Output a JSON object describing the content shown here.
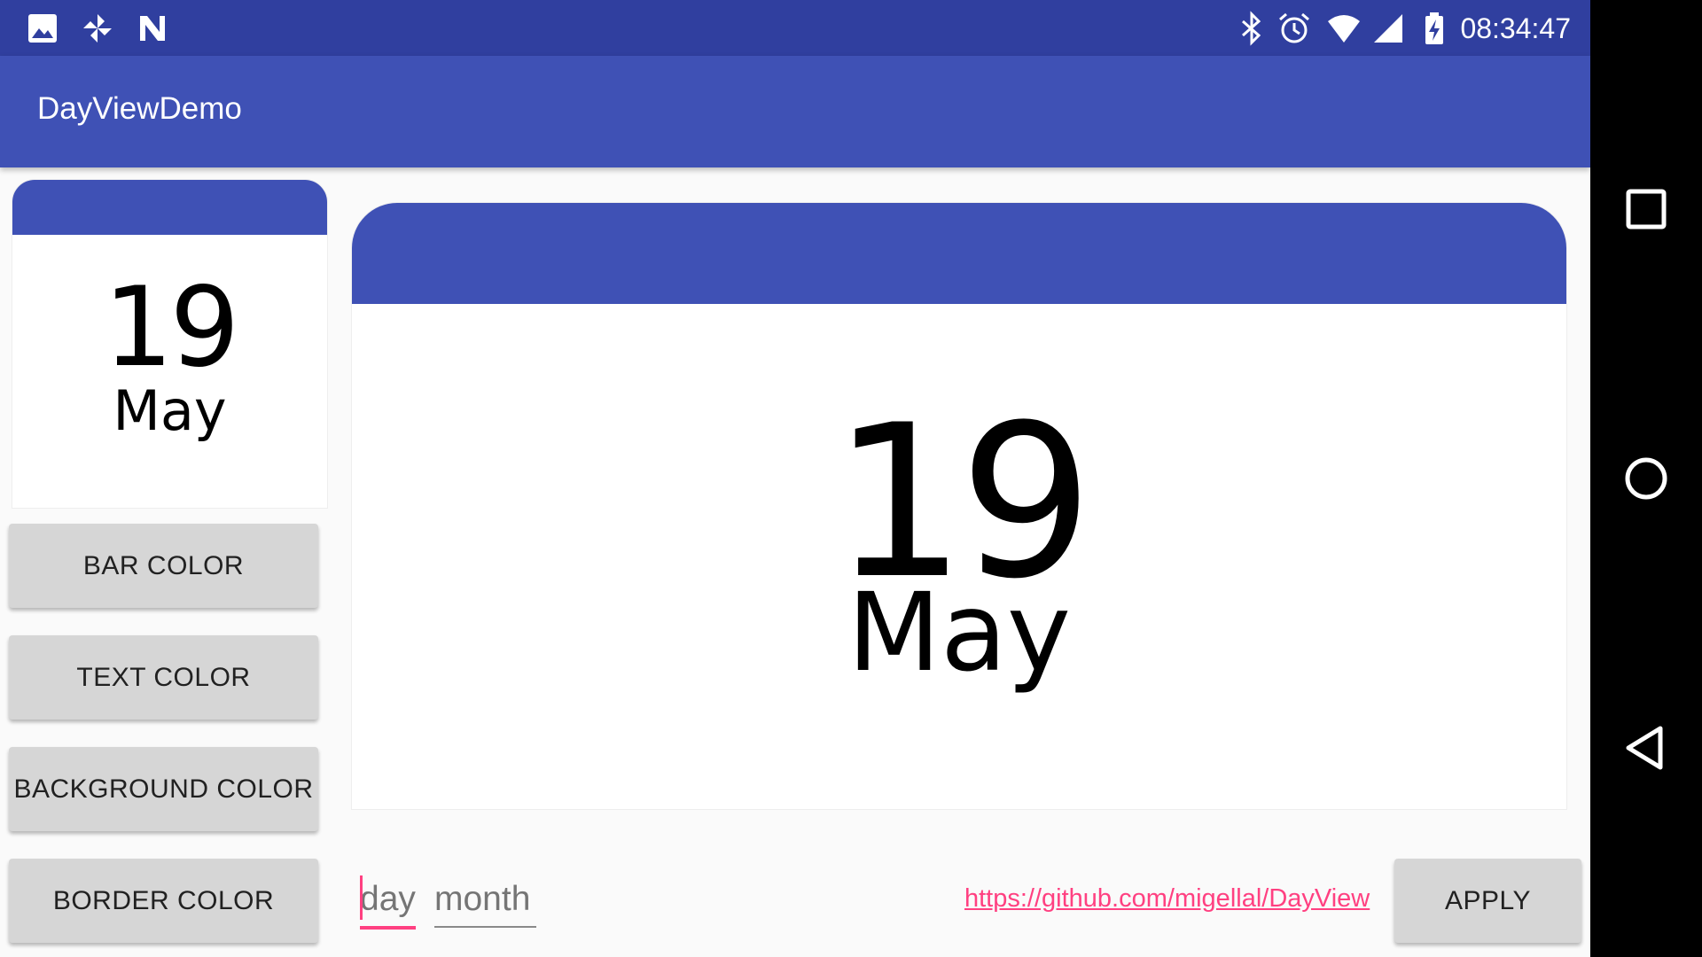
{
  "status_bar": {
    "time": "08:34:47",
    "left_icons": [
      "image-icon",
      "pinwheel-icon",
      "n-logo-icon"
    ],
    "right_icons": [
      "bluetooth-icon",
      "alarm-icon",
      "wifi-icon",
      "signal-icon",
      "battery-charging-icon"
    ]
  },
  "app_bar": {
    "title": "DayViewDemo"
  },
  "small_day_view": {
    "day": "19",
    "month": "May",
    "bar_color": "#3f51b5"
  },
  "large_day_view": {
    "day": "19",
    "month": "May",
    "bar_color": "#3f51b5"
  },
  "buttons": {
    "bar_color": "BAR COLOR",
    "text_color": "TEXT COLOR",
    "background_color": "BACKGROUND COLOR",
    "border_color": "BORDER COLOR",
    "apply": "APPLY"
  },
  "inputs": {
    "day_placeholder": "day",
    "month_placeholder": "month"
  },
  "link": {
    "text": "https://github.com/migellal/DayView"
  },
  "nav_bar": {
    "icons": [
      "recents-square-icon",
      "home-circle-icon",
      "back-triangle-icon"
    ]
  },
  "colors": {
    "primary": "#3f51b5",
    "primary_dark": "#303f9f",
    "accent": "#ff4081"
  }
}
